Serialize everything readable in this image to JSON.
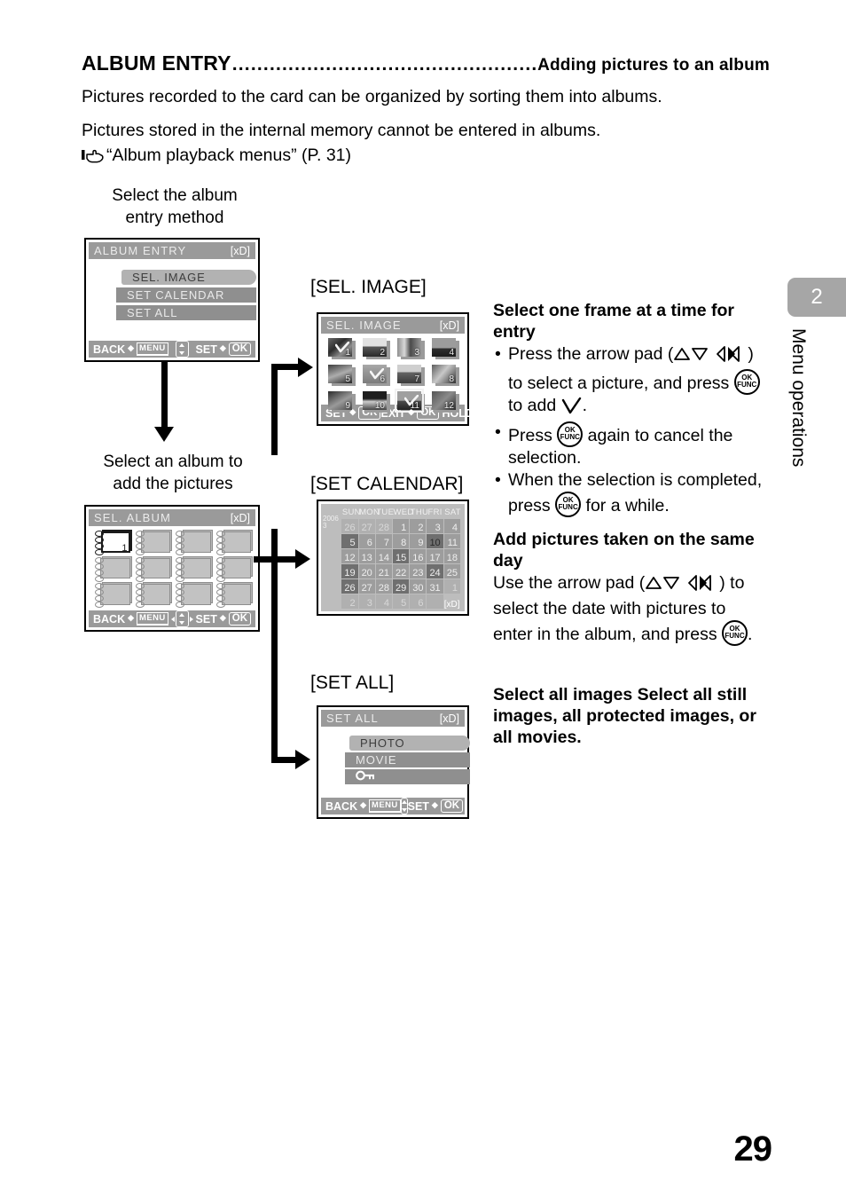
{
  "header": {
    "title": "ALBUM ENTRY",
    "dots": "..................................................",
    "subtitle": "Adding pictures to an album",
    "intro_line1": "Pictures recorded to the card can be organized by sorting them into albums.",
    "intro_line2": "Pictures stored in the internal memory cannot be entered in albums.",
    "reference": "“Album playback menus” (P. 31)"
  },
  "captions": {
    "method": "Select the album\nentry method",
    "album": "Select an album to\nadd the pictures"
  },
  "screen_labels": {
    "sel_image": "[SEL. IMAGE]",
    "set_calendar": "[SET CALENDAR]",
    "set_all": "[SET ALL]"
  },
  "screens": {
    "album_entry": {
      "title": "ALBUM ENTRY",
      "card": "[xD]",
      "items": [
        {
          "label": "SEL. IMAGE",
          "selected": true
        },
        {
          "label": "SET CALENDAR",
          "selected": false
        },
        {
          "label": "SET ALL",
          "selected": false
        }
      ],
      "bar": {
        "back": "BACK",
        "back_key": "MENU",
        "set": "SET",
        "set_key": "OK",
        "pad": "up-down-pad"
      }
    },
    "sel_album": {
      "title": "SEL. ALBUM",
      "card": "[xD]",
      "album_count": 12,
      "current_album": 1,
      "current_label": "1",
      "bar": {
        "back": "BACK",
        "back_key": "MENU",
        "set": "SET",
        "set_key": "OK",
        "pad": "four-way-pad"
      }
    },
    "sel_image": {
      "title": "SEL. IMAGE",
      "card": "[xD]",
      "thumbnails": [
        {
          "num": "1",
          "checked": true,
          "current": false
        },
        {
          "num": "2",
          "checked": false,
          "current": false
        },
        {
          "num": "3",
          "checked": false,
          "current": false
        },
        {
          "num": "4",
          "checked": false,
          "current": false
        },
        {
          "num": "5",
          "checked": false,
          "current": false
        },
        {
          "num": "6",
          "checked": true,
          "current": false
        },
        {
          "num": "7",
          "checked": false,
          "current": false
        },
        {
          "num": "8",
          "checked": false,
          "current": false
        },
        {
          "num": "9",
          "checked": false,
          "current": false
        },
        {
          "num": "10",
          "checked": false,
          "current": false
        },
        {
          "num": "11",
          "checked": true,
          "current": true
        },
        {
          "num": "12",
          "checked": false,
          "current": false
        }
      ],
      "bar": {
        "set": "SET",
        "set_key": "OK",
        "exit": "EXIT",
        "exit_key": "OK",
        "hold": "HOLD"
      }
    },
    "set_calendar": {
      "card": "[xD]",
      "year": "2006",
      "month": "3",
      "weekdays": [
        "SUN",
        "MON",
        "TUE",
        "WED",
        "THU",
        "FRI",
        "SAT"
      ],
      "weeks": [
        [
          {
            "d": "26",
            "dim": true
          },
          {
            "d": "27",
            "dim": true
          },
          {
            "d": "28",
            "dim": true
          },
          {
            "d": "1"
          },
          {
            "d": "2"
          },
          {
            "d": "3"
          },
          {
            "d": "4"
          }
        ],
        [
          {
            "d": "5",
            "pic": true
          },
          {
            "d": "6"
          },
          {
            "d": "7"
          },
          {
            "d": "8"
          },
          {
            "d": "9"
          },
          {
            "d": "10",
            "pic": true,
            "cur": true
          },
          {
            "d": "11"
          }
        ],
        [
          {
            "d": "12"
          },
          {
            "d": "13"
          },
          {
            "d": "14"
          },
          {
            "d": "15",
            "pic": true
          },
          {
            "d": "16"
          },
          {
            "d": "17"
          },
          {
            "d": "18"
          }
        ],
        [
          {
            "d": "19",
            "pic": true
          },
          {
            "d": "20"
          },
          {
            "d": "21"
          },
          {
            "d": "22"
          },
          {
            "d": "23"
          },
          {
            "d": "24",
            "pic": true
          },
          {
            "d": "25"
          }
        ],
        [
          {
            "d": "26",
            "pic": true
          },
          {
            "d": "27"
          },
          {
            "d": "28"
          },
          {
            "d": "29",
            "pic": true
          },
          {
            "d": "30"
          },
          {
            "d": "31"
          },
          {
            "d": "1",
            "dim": true
          }
        ],
        [
          {
            "d": "2",
            "dim": true
          },
          {
            "d": "3",
            "dim": true
          },
          {
            "d": "4",
            "dim": true
          },
          {
            "d": "5",
            "dim": true
          },
          {
            "d": "6",
            "dim": true
          },
          {
            "d": "",
            "dim": true
          },
          {
            "d": "",
            "dim": true,
            "xd": true
          }
        ]
      ]
    },
    "set_all": {
      "title": "SET ALL",
      "card": "[xD]",
      "items": [
        {
          "label": "PHOTO",
          "selected": true
        },
        {
          "label": "MOVIE",
          "selected": false
        },
        {
          "label": "",
          "icon": "key-protect-icon",
          "selected": false
        }
      ],
      "bar": {
        "back": "BACK",
        "back_key": "MENU",
        "set": "SET",
        "set_key": "OK",
        "pad": "up-down-pad"
      }
    }
  },
  "instructions": {
    "sel_image": {
      "heading": "Select one frame at a time for entry",
      "bullets": [
        {
          "pre": "Press the arrow pad (",
          "mid": ") to select a picture, and press ",
          "post": " to add ",
          "end": "."
        },
        {
          "pre": "Press ",
          "post": " again to cancel the selection."
        },
        {
          "pre": "When the selection is completed, press ",
          "post": " for a while."
        }
      ]
    },
    "set_calendar": {
      "heading": "Add pictures taken on the same day",
      "pre": "Use the arrow pad (",
      "post": ") to select the date with pictures to enter in the album, and press ",
      "end": "."
    },
    "set_all": {
      "heading": "Select all images Select all still images, all protected images, or all movies."
    }
  },
  "side_tab": {
    "chapter": "2",
    "section": "Menu operations"
  },
  "page_number": "29",
  "ok_button": {
    "top": "OK",
    "bottom": "FUNC"
  }
}
